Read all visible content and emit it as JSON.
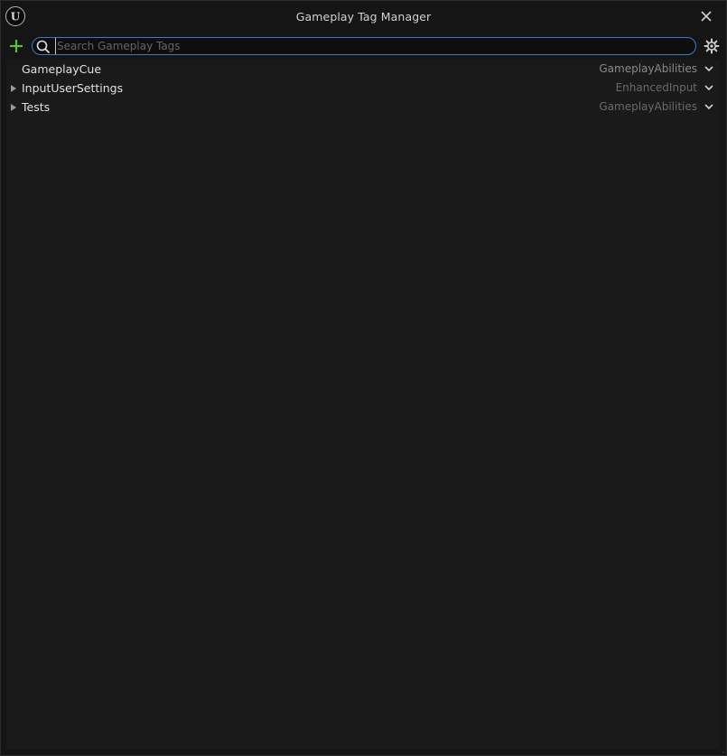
{
  "window": {
    "title": "Gameplay Tag Manager",
    "app_icon": "unreal-engine-logo-icon",
    "close_icon": "close-icon"
  },
  "toolbar": {
    "add_icon": "plus-icon",
    "add_color": "#5fbf3a",
    "search": {
      "placeholder": "Search Gameplay Tags",
      "value": "",
      "icon": "search-icon"
    },
    "settings_icon": "gear-icon"
  },
  "tags": [
    {
      "name": "GameplayCue",
      "source": "GameplayAbilities",
      "expandable": false
    },
    {
      "name": "InputUserSettings",
      "source": "EnhancedInput",
      "expandable": true
    },
    {
      "name": "Tests",
      "source": "GameplayAbilities",
      "expandable": true
    }
  ],
  "colors": {
    "background": "#151515",
    "panel": "#1a1a1a",
    "search_focus_border": "#3e79c9"
  }
}
